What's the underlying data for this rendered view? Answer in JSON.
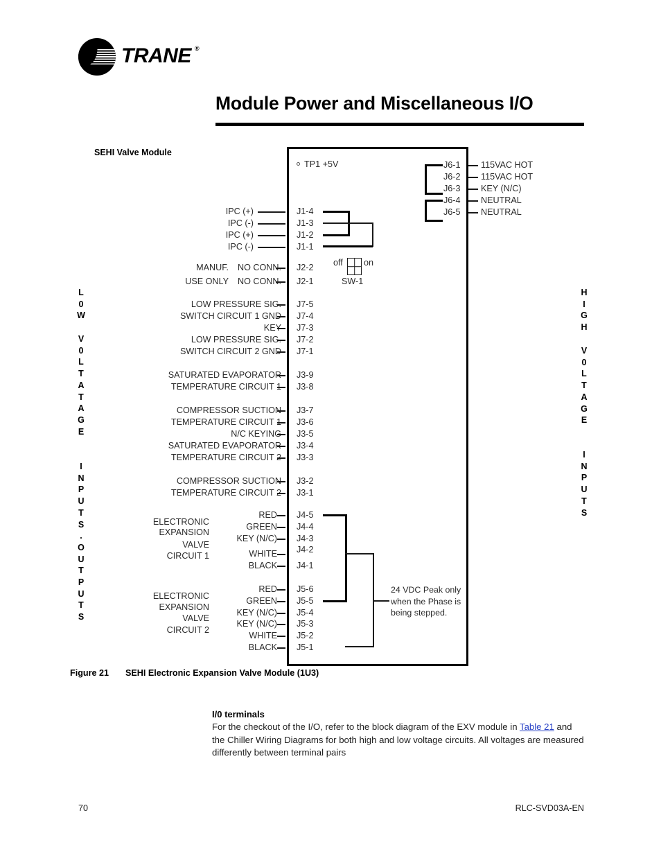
{
  "brand": {
    "logo_text": "TRANE",
    "registered_mark": "®"
  },
  "header": {
    "title": "Module Power and Miscellaneous I/O"
  },
  "section": {
    "label": "SEHI Valve Module"
  },
  "diagram": {
    "test_point": {
      "label": "TP1  +5V",
      "marker": "degree-circle"
    },
    "dip_switch": {
      "name": "SW-1",
      "off_label": "off",
      "on_label": "on"
    },
    "left_column_text": "L 0 W  V 0 L T A T A G E  I N P U T S . O U T P U T S",
    "left_column_groups": [
      [
        "L",
        "0",
        "W"
      ],
      [
        "V",
        "0",
        "L",
        "T",
        "A",
        "T",
        "A",
        "G",
        "E"
      ],
      [
        "I",
        "N",
        "P",
        "U",
        "T",
        "S",
        ".",
        "O",
        "U",
        "T",
        "P",
        "U",
        "T",
        "S"
      ]
    ],
    "right_column_text": "H I G H  V 0 L T A G E  I N P U T S",
    "right_column_groups": [
      [
        "H",
        "I",
        "G",
        "H"
      ],
      [
        "V",
        "0",
        "L",
        "T",
        "A",
        "G",
        "E"
      ],
      [
        "I",
        "N",
        "P",
        "U",
        "T",
        "S"
      ]
    ],
    "note": "24 VDC Peak only when the Phase is being stepped.",
    "j6": [
      {
        "pin": "J6-1",
        "label": "115VAC HOT"
      },
      {
        "pin": "J6-2",
        "label": "115VAC HOT"
      },
      {
        "pin": "J6-3",
        "label": "KEY (N/C)"
      },
      {
        "pin": "J6-4",
        "label": "NEUTRAL"
      },
      {
        "pin": "J6-5",
        "label": "NEUTRAL"
      }
    ],
    "j1": [
      {
        "pin": "J1-4",
        "label": "IPC (+)"
      },
      {
        "pin": "J1-3",
        "label": "IPC (-)"
      },
      {
        "pin": "J1-2",
        "label": "IPC (+)"
      },
      {
        "pin": "J1-1",
        "label": "IPC (-)"
      }
    ],
    "j2_group_label_line1": "MANUF.",
    "j2_group_label_line2": "USE ONLY",
    "j2": [
      {
        "pin": "J2-2",
        "label": "NO CONN."
      },
      {
        "pin": "J2-1",
        "label": "NO CONN."
      }
    ],
    "j7": [
      {
        "pin": "J7-5",
        "label": "LOW PRESSURE SIG."
      },
      {
        "pin": "J7-4",
        "label": "SWITCH CIRCUIT 1 GND"
      },
      {
        "pin": "J7-3",
        "label": "KEY"
      },
      {
        "pin": "J7-2",
        "label": "LOW PRESSURE SIG."
      },
      {
        "pin": "J7-1",
        "label": "SWITCH CIRCUIT 2 GND"
      }
    ],
    "j3": [
      {
        "pin": "J3-9",
        "label": "SATURATED EVAPORATOR"
      },
      {
        "pin": "J3-8",
        "label": "TEMPERATURE CIRCUIT 1"
      },
      {
        "pin": "J3-7",
        "label": "COMPRESSOR SUCTION"
      },
      {
        "pin": "J3-6",
        "label": "TEMPERATURE CIRCUIT 1"
      },
      {
        "pin": "J3-5",
        "label": "N/C KEYING"
      },
      {
        "pin": "J3-4",
        "label": "SATURATED EVAPORATOR"
      },
      {
        "pin": "J3-3",
        "label": "TEMPERATURE CIRCUIT 2"
      },
      {
        "pin": "J3-2",
        "label": "COMPRESSOR SUCTION"
      },
      {
        "pin": "J3-1",
        "label": "TEMPERATURE CIRCUIT 2"
      }
    ],
    "j4_group_label": [
      "ELECTRONIC",
      "EXPANSION",
      "VALVE",
      "CIRCUIT 1"
    ],
    "j4": [
      {
        "pin": "J4-5",
        "label": "RED"
      },
      {
        "pin": "J4-4",
        "label": "GREEN"
      },
      {
        "pin": "J4-3",
        "label": "KEY (N/C)"
      },
      {
        "pin": "J4-2",
        "label": "WHITE"
      },
      {
        "pin": "J4-1",
        "label": "BLACK"
      }
    ],
    "j5_group_label": [
      "ELECTRONIC",
      "EXPANSION",
      "VALVE",
      "CIRCUIT 2"
    ],
    "j5": [
      {
        "pin": "J5-6",
        "label": "RED"
      },
      {
        "pin": "J5-5",
        "label": "GREEN"
      },
      {
        "pin": "J5-4",
        "label": "KEY (N/C)"
      },
      {
        "pin": "J5-3",
        "label": "KEY (N/C)"
      },
      {
        "pin": "J5-2",
        "label": "WHITE"
      },
      {
        "pin": "J5-1",
        "label": "BLACK"
      }
    ]
  },
  "caption": {
    "number": "Figure 21",
    "text": "SEHI Electronic Expansion Valve Module (1U3)"
  },
  "body": {
    "heading": "I/0 terminals",
    "line1_before": "For the checkout of the I/O, refer to the block diagram of the EXV module in",
    "link": "Table 21",
    "line2_after": " and the Chiller Wiring Diagrams for both high and low voltage",
    "line3": "circuits. All voltages are measured differently between terminal pairs"
  },
  "footer": {
    "page_number": "70",
    "document_code": "RLC-SVD03A-EN"
  },
  "colors": {
    "link": "#2b44c7",
    "ink": "#000000",
    "diagram_ink": "#2b2b2b"
  }
}
